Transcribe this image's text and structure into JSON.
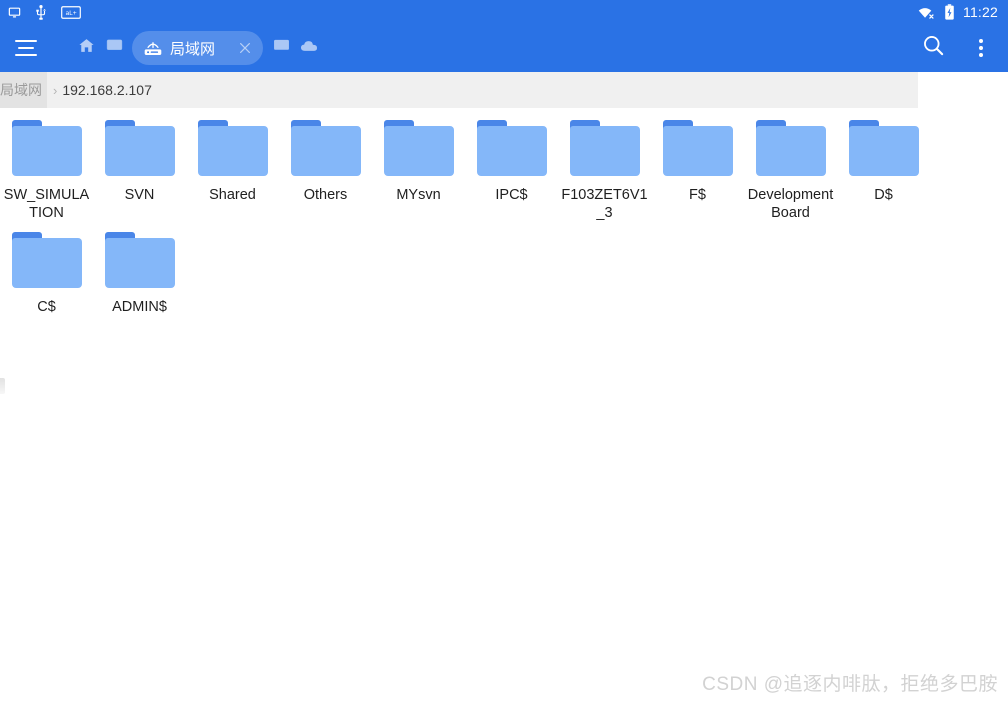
{
  "theme": {
    "accent": "#2a72e5",
    "folder_body": "#84b7f9",
    "folder_tab": "#4a86e8",
    "crumbbar_bg": "#f0f0f0",
    "crumb_active_bg": "#e3e3e3",
    "page_bg": "#ffffff",
    "watermark_color": "#d2d2d2"
  },
  "statusbar": {
    "left_icons": [
      {
        "name": "screen-cast-icon",
        "glyph": "screen"
      },
      {
        "name": "usb-icon",
        "glyph": "usb"
      },
      {
        "name": "adb-box-icon",
        "glyph": "adb",
        "text": "aL+"
      }
    ],
    "right_icons": [
      {
        "name": "wifi-off-icon",
        "glyph": "wifi-x"
      },
      {
        "name": "battery-charging-icon",
        "glyph": "battery"
      }
    ],
    "time": "11:22"
  },
  "toolbar": {
    "menu_label": "menu",
    "tabs_before": [
      {
        "name": "tab-home",
        "icon": "home-icon"
      },
      {
        "name": "tab-local",
        "icon": "monitor-icon"
      }
    ],
    "active_tab": {
      "label": "局域网",
      "icon": "router-icon",
      "close_label": "×"
    },
    "tabs_after": [
      {
        "name": "tab-remote",
        "icon": "monitor-icon"
      },
      {
        "name": "tab-cloud",
        "icon": "cloud-icon"
      }
    ],
    "search_label": "search",
    "more_label": "more options"
  },
  "breadcrumb": {
    "root": "局域网",
    "separator": "›",
    "current": "192.168.2.107"
  },
  "files": {
    "items": [
      {
        "name": "SW_SIMULATION",
        "type": "folder"
      },
      {
        "name": "SVN",
        "type": "folder"
      },
      {
        "name": "Shared",
        "type": "folder"
      },
      {
        "name": "Others",
        "type": "folder"
      },
      {
        "name": "MYsvn",
        "type": "folder"
      },
      {
        "name": "IPC$",
        "type": "folder"
      },
      {
        "name": "F103ZET6V1_3",
        "type": "folder"
      },
      {
        "name": "F$",
        "type": "folder"
      },
      {
        "name": "DevelopmentBoard",
        "type": "folder"
      },
      {
        "name": "D$",
        "type": "folder"
      },
      {
        "name": "C$",
        "type": "folder"
      },
      {
        "name": "ADMIN$",
        "type": "folder"
      }
    ]
  },
  "watermark": {
    "text": "CSDN @追逐内啡肽，拒绝多巴胺"
  }
}
